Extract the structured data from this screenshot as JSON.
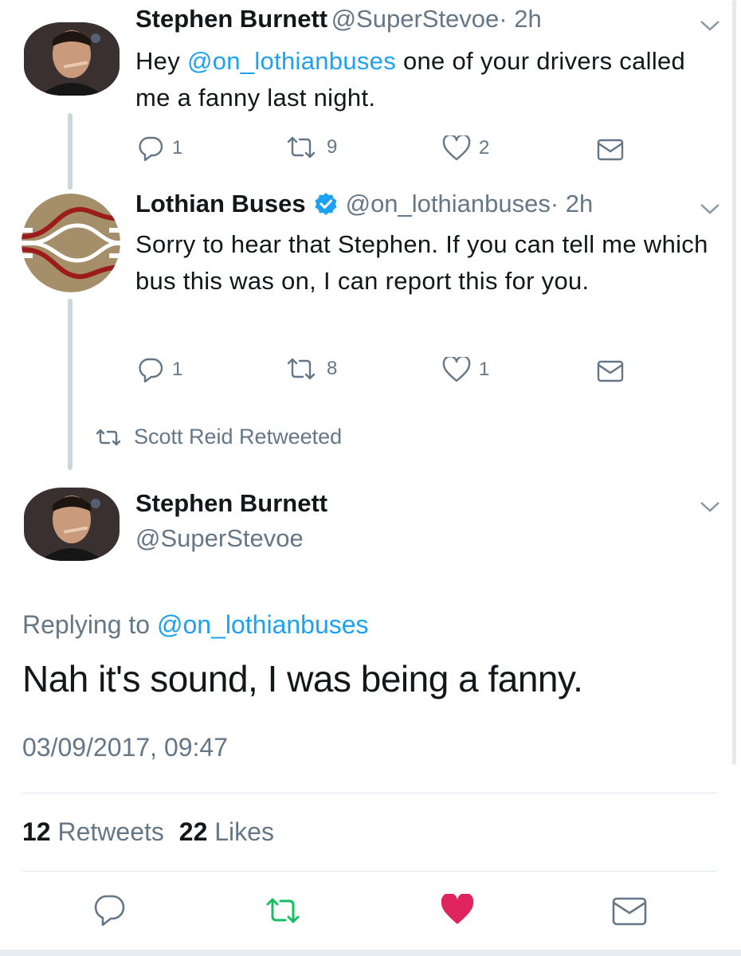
{
  "tweet1": {
    "name": "Stephen Burnett",
    "handle": "@SuperStevoe",
    "time": "· 2h",
    "text_prefix": "Hey ",
    "mention": "@on_lothianbuses",
    "text_suffix": " one of your drivers called me a fanny last night.",
    "replies": "1",
    "retweets": "9",
    "likes": "2"
  },
  "tweet2": {
    "name": "Lothian Buses",
    "handle": "@on_lothianbuses",
    "time": "· 2h",
    "text": "Sorry to hear that Stephen. If you can tell me which bus this was on, I can report this for you.",
    "replies": "1",
    "retweets": "8",
    "likes": "1"
  },
  "retweeted_by": "Scott Reid Retweeted",
  "main_tweet": {
    "name": "Stephen Burnett",
    "handle": "@SuperStevoe",
    "replying_label": "Replying to ",
    "replying_mention": "@on_lothianbuses",
    "text": "Nah it's sound, I was being a fanny.",
    "timestamp": "03/09/2017, 09:47",
    "retweet_count": "12",
    "retweet_label": "Retweets",
    "like_count": "22",
    "like_label": "Likes"
  },
  "icons": {
    "reply": "reply-icon",
    "retweet": "retweet-icon",
    "like": "heart-icon",
    "message": "envelope-icon",
    "verified": "verified-badge-icon",
    "chevron": "chevron-down-icon"
  },
  "colors": {
    "accent": "#1da1f2",
    "retweet_active": "#17bf63",
    "like_active": "#e0245e",
    "muted": "#657786",
    "text": "#14171a"
  }
}
